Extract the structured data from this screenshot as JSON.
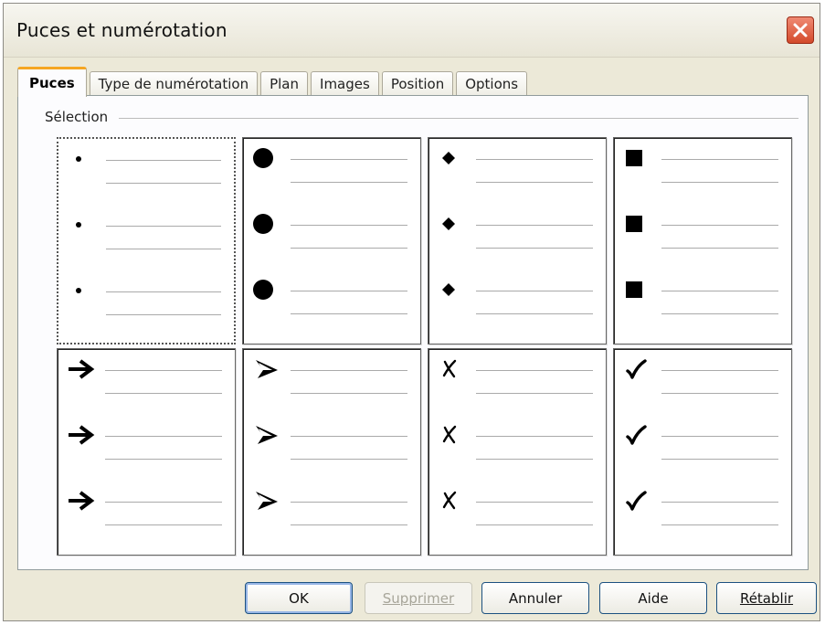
{
  "window": {
    "title": "Puces et numérotation"
  },
  "tabs": [
    {
      "label": "Puces",
      "active": true
    },
    {
      "label": "Type de numérotation",
      "active": false
    },
    {
      "label": "Plan",
      "active": false
    },
    {
      "label": "Images",
      "active": false
    },
    {
      "label": "Position",
      "active": false
    },
    {
      "label": "Options",
      "active": false
    }
  ],
  "selection": {
    "label": "Sélection",
    "styles": [
      {
        "name": "small-dot",
        "icon": "small-dot-bullet-icon",
        "selected": true
      },
      {
        "name": "large-dot",
        "icon": "large-dot-bullet-icon",
        "selected": false
      },
      {
        "name": "diamond",
        "icon": "diamond-bullet-icon",
        "selected": false
      },
      {
        "name": "square",
        "icon": "square-bullet-icon",
        "selected": false
      },
      {
        "name": "arrow",
        "icon": "arrow-bullet-icon",
        "selected": false
      },
      {
        "name": "arrowhead",
        "icon": "arrowhead-bullet-icon",
        "selected": false
      },
      {
        "name": "cross",
        "icon": "cross-bullet-icon",
        "selected": false
      },
      {
        "name": "checkmark",
        "icon": "checkmark-bullet-icon",
        "selected": false
      }
    ]
  },
  "buttons": {
    "ok": "OK",
    "delete": "Supprimer",
    "cancel": "Annuler",
    "help": "Aide",
    "reset": "Rétablir"
  },
  "colors": {
    "dialog_bg": "#ece9d8",
    "active_tab_accent": "#f5a623",
    "close_button": "#d34a2b",
    "button_border": "#1c5180"
  }
}
